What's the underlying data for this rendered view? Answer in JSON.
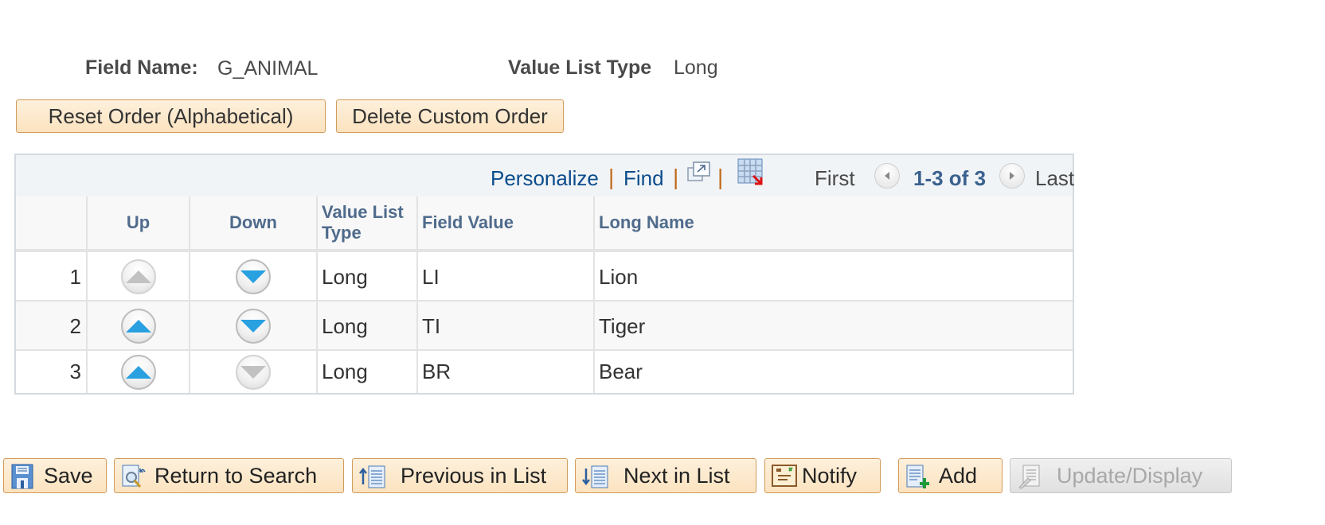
{
  "header": {
    "field_name_label": "Field Name:",
    "field_name_value": "G_ANIMAL",
    "value_list_type_label": "Value List Type",
    "value_list_type_value": "Long"
  },
  "actions": {
    "reset_order": "Reset Order (Alphabetical)",
    "delete_custom_order": "Delete Custom Order"
  },
  "grid": {
    "nav": {
      "personalize": "Personalize",
      "find": "Find",
      "separator": "|",
      "first": "First",
      "range": "1-3 of 3",
      "last": "Last",
      "icons": [
        "view-all-icon",
        "download-grid-icon",
        "previous-page-icon",
        "next-page-icon"
      ]
    },
    "columns": [
      "",
      "Up",
      "Down",
      "Value List Type",
      "Field Value",
      "Long Name"
    ],
    "rows": [
      {
        "num": "1",
        "up_enabled": false,
        "down_enabled": true,
        "type": "Long",
        "field_value": "LI",
        "long_name": "Lion"
      },
      {
        "num": "2",
        "up_enabled": true,
        "down_enabled": true,
        "type": "Long",
        "field_value": "TI",
        "long_name": "Tiger"
      },
      {
        "num": "3",
        "up_enabled": true,
        "down_enabled": false,
        "type": "Long",
        "field_value": "BR",
        "long_name": "Bear"
      }
    ]
  },
  "toolbar": {
    "save": "Save",
    "return_to_search": "Return to Search",
    "previous_in_list": "Previous in List",
    "next_in_list": "Next in List",
    "notify": "Notify",
    "add": "Add",
    "update_display": "Update/Display"
  },
  "colors": {
    "button_border": "#d39b5a",
    "link": "#0a4c8c",
    "header_text": "#4f6b8c",
    "arrow_active": "#29a0e0",
    "arrow_disabled": "#c2c2c2"
  }
}
